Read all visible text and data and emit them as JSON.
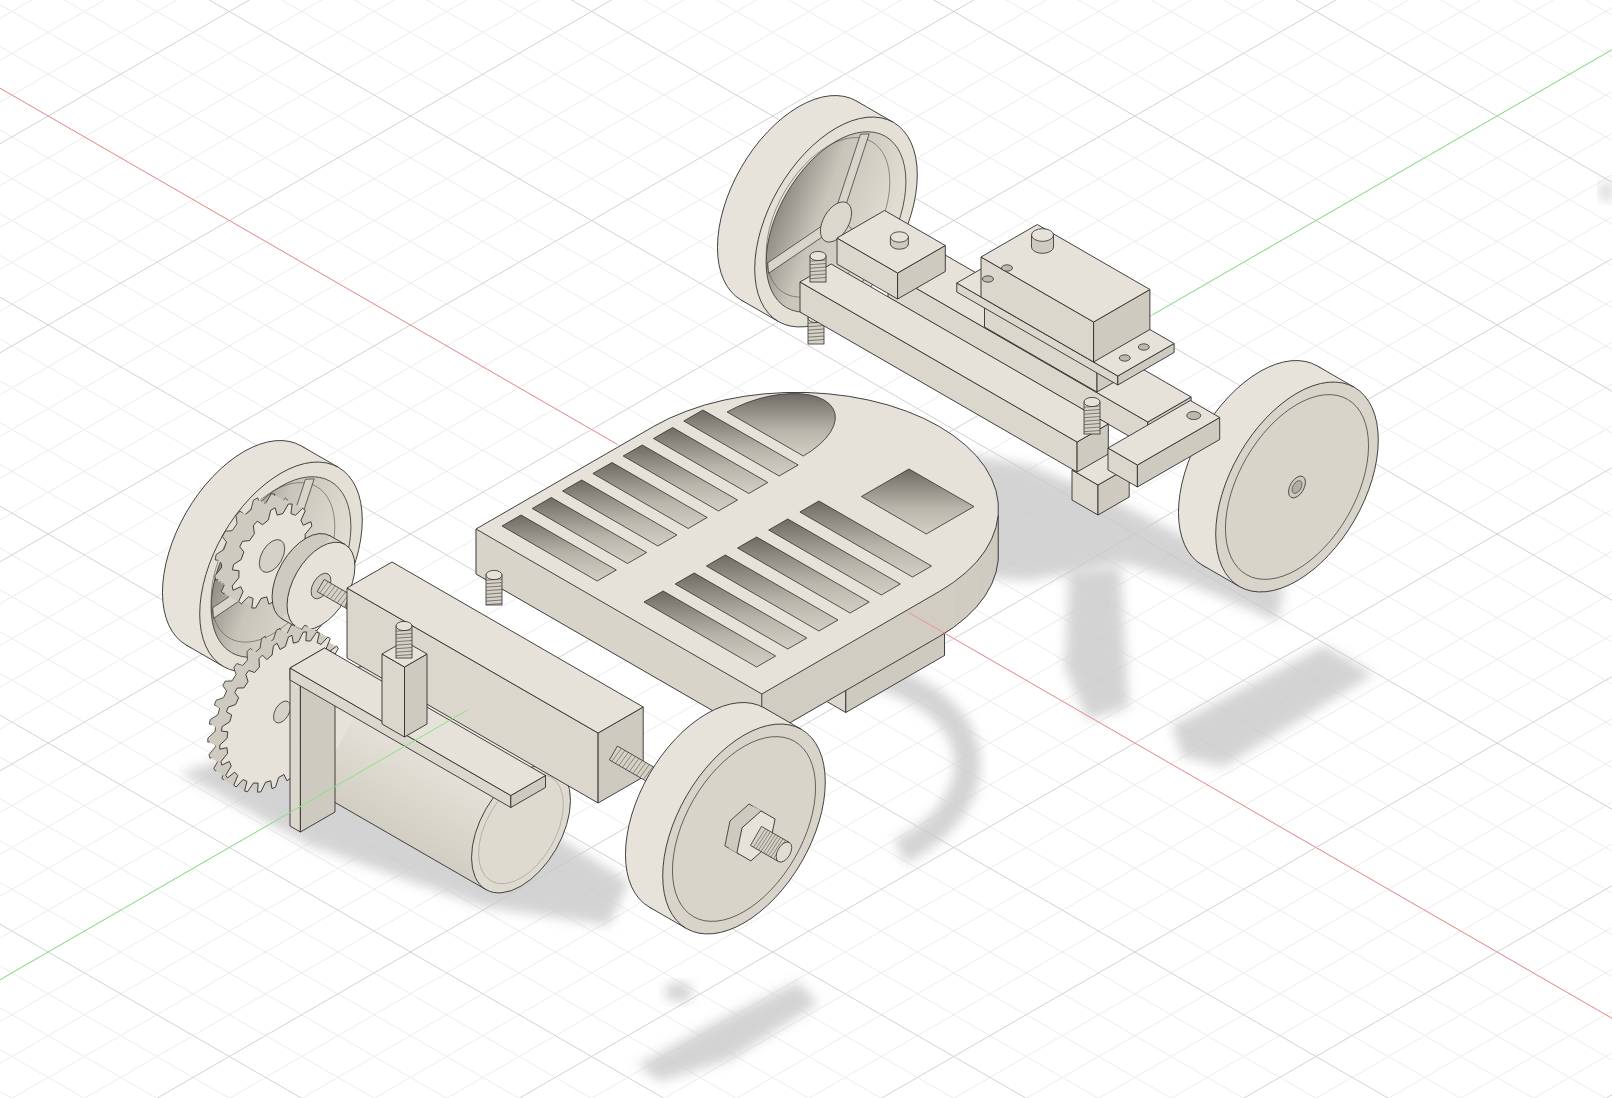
{
  "viewport": {
    "grid": true,
    "axes": [
      {
        "color": "#f39090"
      },
      {
        "color": "#86e486"
      }
    ]
  }
}
